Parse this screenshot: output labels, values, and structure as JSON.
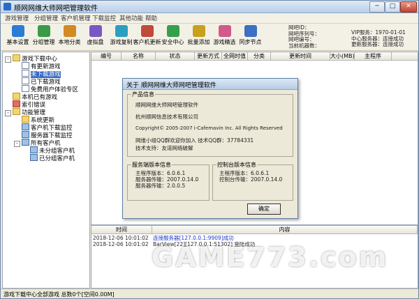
{
  "window": {
    "title": "顺网网维大师网吧管理软件",
    "min": "─",
    "max": "□",
    "close": "✕"
  },
  "menu": [
    "游戏管理",
    "分组管理",
    "客户机管理",
    "下载监控",
    "其他功能",
    "帮助"
  ],
  "toolbar": [
    {
      "label": "基本设置",
      "icon": "settings-icon",
      "color": "#2e7bd6"
    },
    {
      "label": "分组管理",
      "icon": "group-icon",
      "color": "#3a9a4a"
    },
    {
      "label": "本地分类",
      "icon": "category-icon",
      "color": "#d28a22"
    },
    {
      "label": "虚拟盘",
      "icon": "disk-icon",
      "color": "#7a58c4"
    },
    {
      "label": "游戏复制",
      "icon": "copy-icon",
      "color": "#2b9fc0"
    },
    {
      "label": "客户机更新",
      "icon": "update-icon",
      "color": "#c04b3a"
    },
    {
      "label": "安全中心",
      "icon": "shield-icon",
      "color": "#35a048"
    },
    {
      "label": "批量添加",
      "icon": "batch-add-icon",
      "color": "#c8a01e"
    },
    {
      "label": "游戏精选",
      "icon": "star-icon",
      "color": "#d25a8a"
    },
    {
      "label": "同步节点",
      "icon": "sync-icon",
      "color": "#3d6fc2"
    }
  ],
  "server_info": {
    "left": [
      "网吧ID：",
      "网吧序列号：",
      "网吧编号：",
      "当前机器数："
    ],
    "right": [
      "VIP服务：1970-01-01",
      "中心服务器：连接成功",
      "更新服务器：连接成功"
    ]
  },
  "tree": [
    {
      "label": "游戏下载中心",
      "level": 0,
      "exp": "-",
      "icon": "folder"
    },
    {
      "label": "有更新游戏",
      "level": 1,
      "icon": "doc"
    },
    {
      "label": "未下载游戏",
      "level": 1,
      "icon": "doc",
      "selected": true
    },
    {
      "label": "已下载游戏",
      "level": 1,
      "icon": "doc"
    },
    {
      "label": "免费用户体验专区",
      "level": 1,
      "icon": "doc"
    },
    {
      "label": "本机已有游戏",
      "level": 0,
      "icon": "folder"
    },
    {
      "label": "索引错误",
      "level": 0,
      "icon": "red"
    },
    {
      "label": "功能管理",
      "level": 0,
      "exp": "-",
      "icon": "folder"
    },
    {
      "label": "系统更新",
      "level": 1,
      "icon": "folder"
    },
    {
      "label": "客户机下载监控",
      "level": 1,
      "icon": "pc"
    },
    {
      "label": "服务器下载监控",
      "level": 1,
      "icon": "pc"
    },
    {
      "label": "所有客户机",
      "level": 1,
      "exp": "-",
      "icon": "pc"
    },
    {
      "label": "未分组客户机",
      "level": 2,
      "icon": "pc"
    },
    {
      "label": "已分组客户机",
      "level": 2,
      "icon": "pc"
    }
  ],
  "grid_columns": [
    "编号",
    "名称",
    "状态",
    "更新方式",
    "全网时值",
    "分类",
    "更新时间",
    "大小(MB)",
    "主程序"
  ],
  "log": {
    "columns": [
      "时间",
      "内容"
    ],
    "rows": [
      {
        "time": "2018-12-06 10:01:02",
        "msg": "连接服务器[127.0.0.1:9909]成功",
        "blue": true
      },
      {
        "time": "2018-12-06 10:01:02",
        "msg": "BarView[22][127.0.0.1:51302] 登陆成功",
        "blue": false
      }
    ]
  },
  "status": "游戏下载中心全部游戏 总数0个[空间0.00M]",
  "about": {
    "title": "关于 顺网网维大师网吧管理软件",
    "product_group": "产品信息",
    "product_name": "顺网网维大师网吧管理软件",
    "company": "杭州顺网信息技术有限公司",
    "copyright": "Copyright© 2005-2007 i-Cafemavin Inc. All Rights Reserved",
    "qq_line": "网维小组QQ群欢迎你加入 技术QQ群：37784331",
    "support_line": "技术支持：友道网络破解",
    "server_group": "服务端版本信息",
    "server_lines": [
      "主程序版本：6.0.6.1",
      "服务器传输：2007.0.14.0",
      "服务器传输：2.0.0.5"
    ],
    "client_group": "控制台版本信息",
    "client_lines": [
      "主程序版本：6.0.6.1",
      "控制台传输：2007.0.14.0"
    ],
    "ok": "确定"
  },
  "watermark": "GAME773.com"
}
